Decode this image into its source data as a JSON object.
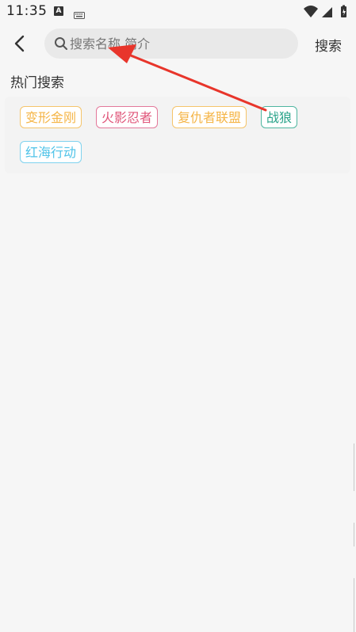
{
  "status_bar": {
    "time": "11:35",
    "notification_letter": "A",
    "icons": [
      "keyboard-icon",
      "wifi-icon",
      "signal-icon",
      "battery-icon"
    ]
  },
  "header": {
    "back_icon": "chevron-left-icon",
    "search_placeholder": "搜索名称 简介",
    "search_value": "",
    "search_button_label": "搜索"
  },
  "hot_search": {
    "title": "热门搜索",
    "tags": [
      {
        "label": "变形金刚",
        "color": "#f5b547"
      },
      {
        "label": "火影忍者",
        "color": "#e0567a"
      },
      {
        "label": "复仇者联盟",
        "color": "#f5b547"
      },
      {
        "label": "战狼",
        "color": "#2aa38a"
      },
      {
        "label": "红海行动",
        "color": "#4fc3e8"
      }
    ]
  },
  "annotation": {
    "arrow_color": "#e8352b"
  }
}
